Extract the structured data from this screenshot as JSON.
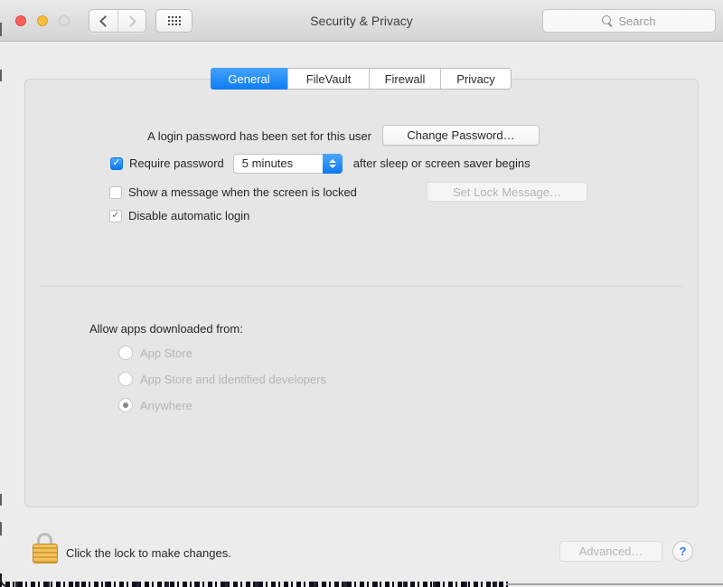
{
  "window": {
    "title": "Security & Privacy"
  },
  "toolbar": {
    "search_placeholder": "Search"
  },
  "icons": {
    "check": "✓",
    "help": "?"
  },
  "tabs": [
    {
      "label": "General",
      "selected": true
    },
    {
      "label": "FileVault",
      "selected": false
    },
    {
      "label": "Firewall",
      "selected": false
    },
    {
      "label": "Privacy",
      "selected": false
    }
  ],
  "general": {
    "password_row": {
      "label": "A login password has been set for this user",
      "button": "Change Password…"
    },
    "require_password": {
      "checked": true,
      "label": "Require password",
      "select_value": "5 minutes",
      "suffix": "after sleep or screen saver begins"
    },
    "lock_message": {
      "checked": false,
      "label": "Show a message when the screen is locked",
      "button": "Set Lock Message…",
      "button_disabled": true
    },
    "auto_login": {
      "checked": true,
      "label": "Disable automatic login"
    },
    "allow_apps": {
      "label": "Allow apps downloaded from:",
      "options": [
        {
          "label": "App Store",
          "selected": false
        },
        {
          "label": "App Store and identified developers",
          "selected": false
        },
        {
          "label": "Anywhere",
          "selected": true
        }
      ]
    }
  },
  "footer": {
    "lock_text": "Click the lock to make changes.",
    "advanced_button": "Advanced…",
    "advanced_disabled": true
  },
  "colors": {
    "accent_blue": "#0f78f3",
    "selected_tab_blue": "#1f86f9",
    "traffic_red": "#f7615c",
    "traffic_yellow": "#f6be40",
    "traffic_gray": "#dfdfdf",
    "window_bg": "#ececec",
    "panel_bg": "#e6e6e6",
    "disabled_text": "#b5b5b5"
  }
}
